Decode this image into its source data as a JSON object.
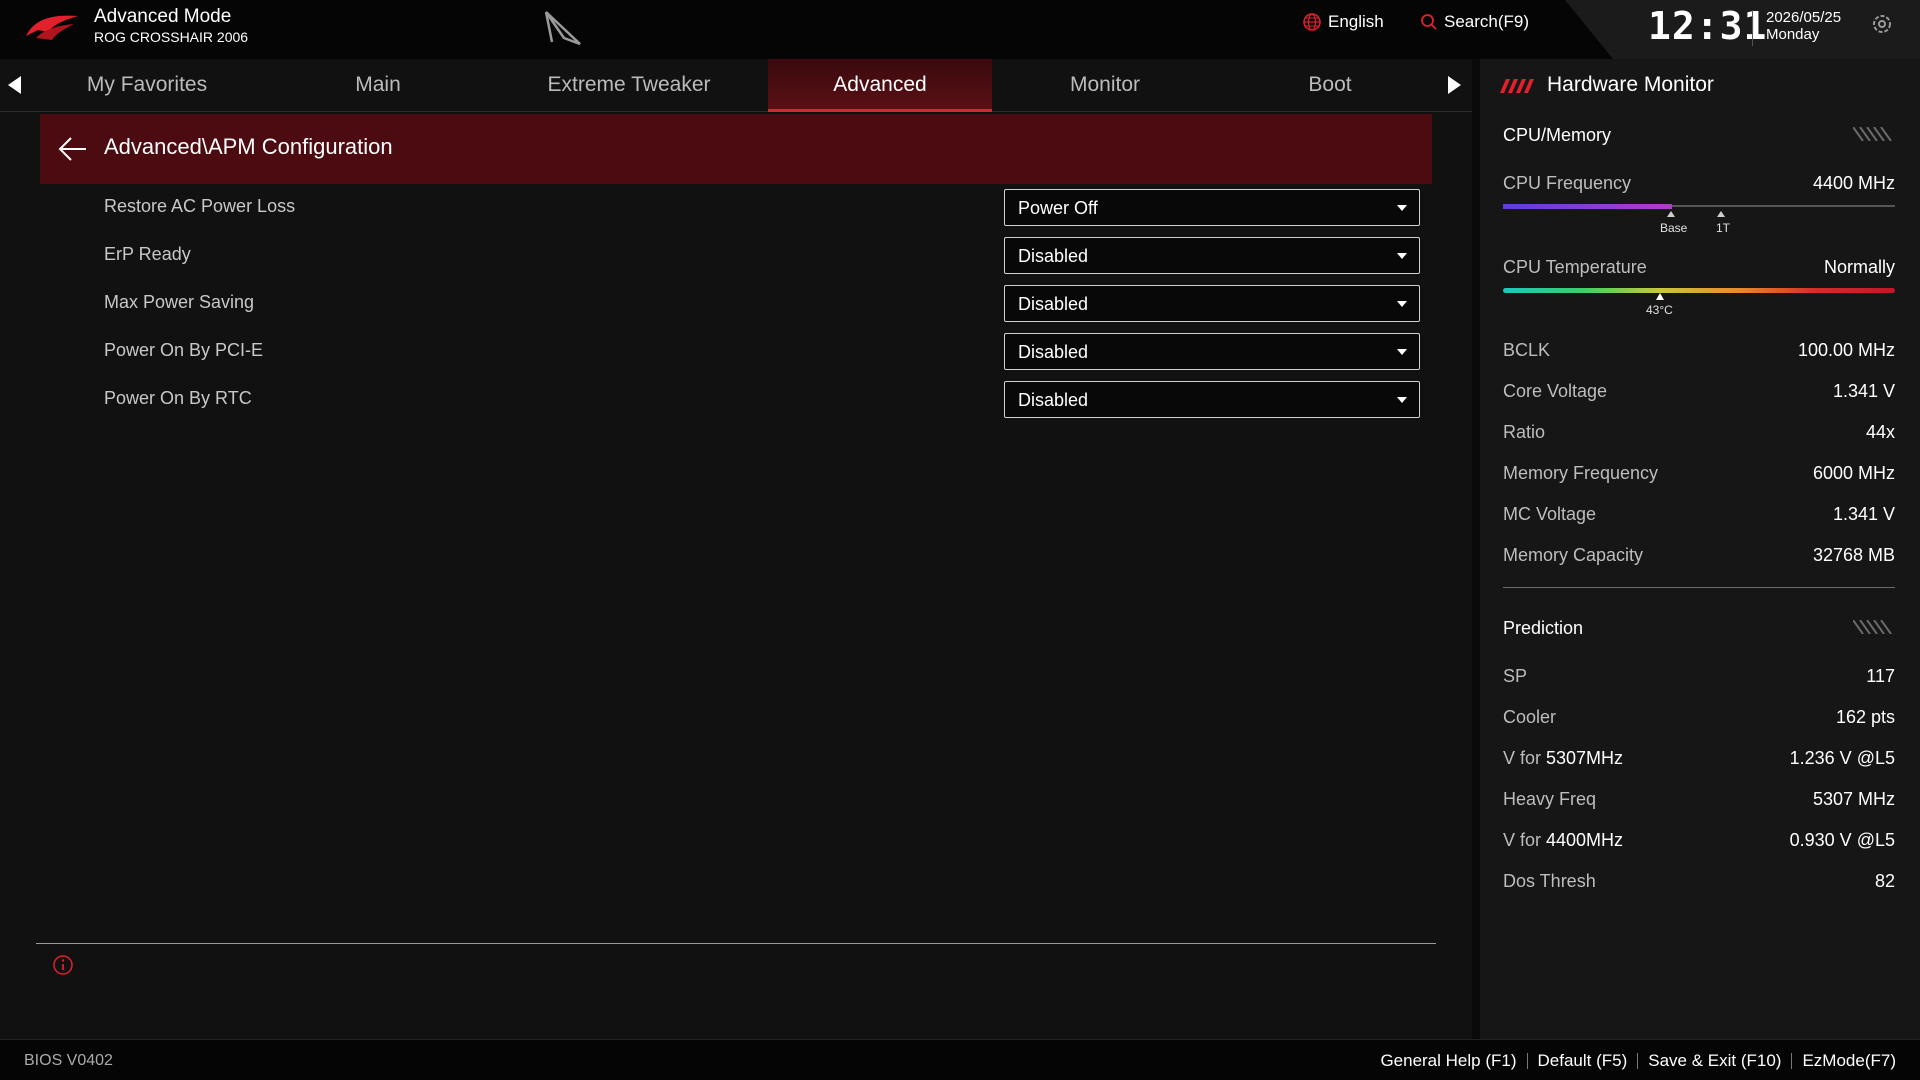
{
  "header": {
    "mode_title": "Advanced Mode",
    "board_name": "ROG CROSSHAIR 2006",
    "language": "English",
    "search": "Search(F9)",
    "time": "12:31",
    "date": "2026/05/25",
    "weekday": "Monday"
  },
  "tabs": [
    {
      "label": "My Favorites",
      "active": false
    },
    {
      "label": "Main",
      "active": false
    },
    {
      "label": "Extreme Tweaker",
      "active": false
    },
    {
      "label": "Advanced",
      "active": true
    },
    {
      "label": "Monitor",
      "active": false
    },
    {
      "label": "Boot",
      "active": false
    }
  ],
  "breadcrumb": "Advanced\\APM Configuration",
  "settings": [
    {
      "label": "Restore AC Power Loss",
      "value": "Power Off"
    },
    {
      "label": "ErP Ready",
      "value": "Disabled"
    },
    {
      "label": "Max Power Saving",
      "value": "Disabled"
    },
    {
      "label": "Power On By PCI-E",
      "value": "Disabled"
    },
    {
      "label": "Power On By RTC",
      "value": "Disabled"
    }
  ],
  "hw": {
    "title": "Hardware Monitor",
    "cpu_memory_title": "CPU/Memory",
    "cpu_freq": {
      "label": "CPU Frequency",
      "value": "4400 MHz",
      "fill_fraction": 0.43,
      "base_label": "Base",
      "one_t_label": "1T"
    },
    "cpu_temp": {
      "label": "CPU Temperature",
      "value": "Normally",
      "marker_label": "43°C",
      "marker_fraction": 0.4
    },
    "rows": [
      {
        "label": "BCLK",
        "value": "100.00 MHz"
      },
      {
        "label": "Core Voltage",
        "value": "1.341 V"
      },
      {
        "label": "Ratio",
        "value": "44x"
      },
      {
        "label": "Memory Frequency",
        "value": "6000 MHz"
      },
      {
        "label": "MC Voltage",
        "value": "1.341 V"
      },
      {
        "label": "Memory Capacity",
        "value": "32768 MB"
      }
    ],
    "prediction_title": "Prediction",
    "prediction": {
      "sp": {
        "label": "SP",
        "value": "117"
      },
      "cooler": {
        "label": "Cooler",
        "value": "162 pts"
      },
      "v1": {
        "label_prefix": "V for ",
        "label_freq": "5307MHz",
        "value": "1.236 V @L5"
      },
      "heavy": {
        "label": "Heavy Freq",
        "value": "5307 MHz"
      },
      "v2": {
        "label_prefix": "V for ",
        "label_freq": "4400MHz",
        "value": "0.930 V @L5"
      },
      "dos": {
        "label": "Dos Thresh",
        "value": "82"
      }
    }
  },
  "footer": {
    "bios_version": "BIOS V0402",
    "general_help": "General Help (F1)",
    "default": "Default (F5)",
    "save_exit": "Save & Exit (F10)",
    "ezmode": "EzMode(F7)"
  },
  "colors": {
    "accent": "#e3202d",
    "crumb_bg": "#4b0b10"
  },
  "icons": [
    "rog-logo-icon",
    "tuf-emblem-icon",
    "globe-icon",
    "search-icon",
    "settings-icon",
    "back-arrow-icon",
    "info-icon",
    "hatch-icon"
  ]
}
